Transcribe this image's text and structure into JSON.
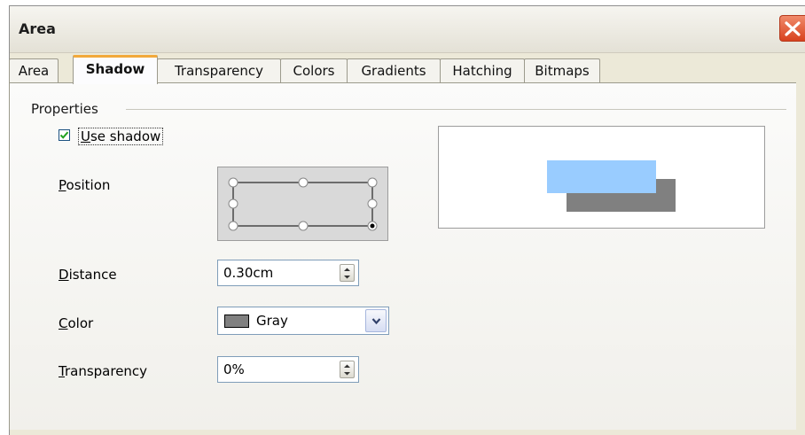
{
  "window": {
    "title": "Area"
  },
  "tabs": [
    {
      "label": "Area",
      "active": false
    },
    {
      "label": "Shadow",
      "active": true
    },
    {
      "label": "Transparency",
      "active": false
    },
    {
      "label": "Colors",
      "active": false
    },
    {
      "label": "Gradients",
      "active": false
    },
    {
      "label": "Hatching",
      "active": false
    },
    {
      "label": "Bitmaps",
      "active": false
    }
  ],
  "properties": {
    "group_label": "Properties",
    "use_shadow": {
      "label": "Use shadow",
      "checked": true
    },
    "position": {
      "label": "Position",
      "selected": "bottom-right"
    },
    "distance": {
      "label": "Distance",
      "value": "0.30cm"
    },
    "color": {
      "label": "Color",
      "value": "Gray",
      "swatch": "#808080"
    },
    "transparency": {
      "label": "Transparency",
      "value": "0%"
    }
  },
  "preview": {
    "object_color": "#99ccff",
    "shadow_color": "#808080"
  },
  "colors": {
    "tab_highlight": "#f2a93b",
    "close_button": "#d8421f",
    "dialog_bg": "#ece9d8"
  },
  "icons": {
    "close": "close-icon",
    "check": "checkmark-icon",
    "spin": "spin-arrows-icon",
    "dropdown": "chevron-down-icon"
  }
}
